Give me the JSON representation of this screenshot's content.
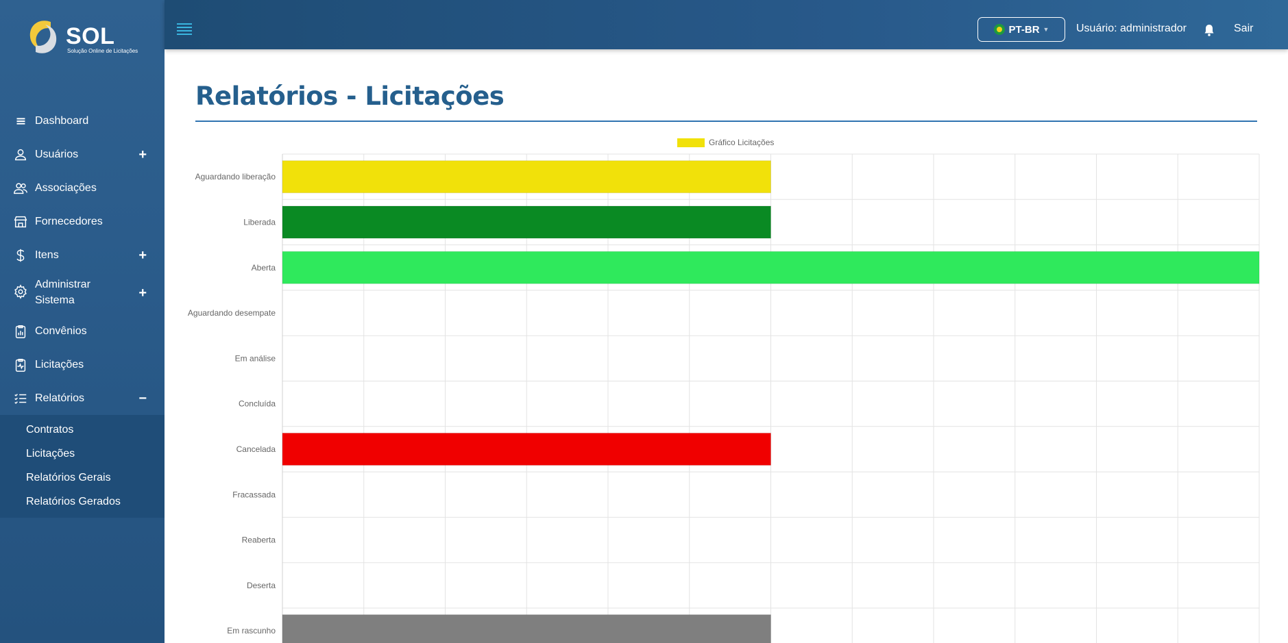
{
  "app": {
    "logo_text": "SOL",
    "logo_subtitle": "Solução Online de Licitações"
  },
  "topbar": {
    "language": "PT-BR",
    "user_label": "Usuário: administrador",
    "logout_label": "Sair"
  },
  "sidebar": {
    "items": [
      {
        "label": "Dashboard",
        "icon": "list-icon",
        "toggle": ""
      },
      {
        "label": "Usuários",
        "icon": "user-icon",
        "toggle": "+"
      },
      {
        "label": "Associações",
        "icon": "users-icon",
        "toggle": ""
      },
      {
        "label": "Fornecedores",
        "icon": "store-icon",
        "toggle": ""
      },
      {
        "label": "Itens",
        "icon": "dollar-icon",
        "toggle": "+"
      },
      {
        "label": "Administrar Sistema",
        "icon": "gear-icon",
        "toggle": "+"
      },
      {
        "label": "Convênios",
        "icon": "clipboard-chart-icon",
        "toggle": ""
      },
      {
        "label": "Licitações",
        "icon": "clipboard-pulse-icon",
        "toggle": ""
      },
      {
        "label": "Relatórios",
        "icon": "checklist-icon",
        "toggle": "−"
      }
    ],
    "submenu": [
      "Contratos",
      "Licitações",
      "Relatórios Gerais",
      "Relatórios Gerados"
    ]
  },
  "main": {
    "title": "Relatórios - Licitações"
  },
  "chart_data": {
    "type": "bar",
    "orientation": "horizontal",
    "legend": "Gráfico Licitações",
    "legend_color": "#f1e10a",
    "categories": [
      "Aguardando liberação",
      "Liberada",
      "Aberta",
      "Aguardando desempate",
      "Em análise",
      "Concluída",
      "Cancelada",
      "Fracassada",
      "Reaberta",
      "Deserta",
      "Em rascunho"
    ],
    "values": [
      1,
      1,
      2,
      0,
      0,
      0,
      1,
      0,
      0,
      0,
      1
    ],
    "colors": [
      "#f1e10a",
      "#0a8a23",
      "#2fe95c",
      "#cccccc",
      "#cccccc",
      "#cccccc",
      "#f00000",
      "#cccccc",
      "#cccccc",
      "#cccccc",
      "#7f7f7f"
    ],
    "xlim": [
      0,
      2
    ],
    "grid": true
  }
}
